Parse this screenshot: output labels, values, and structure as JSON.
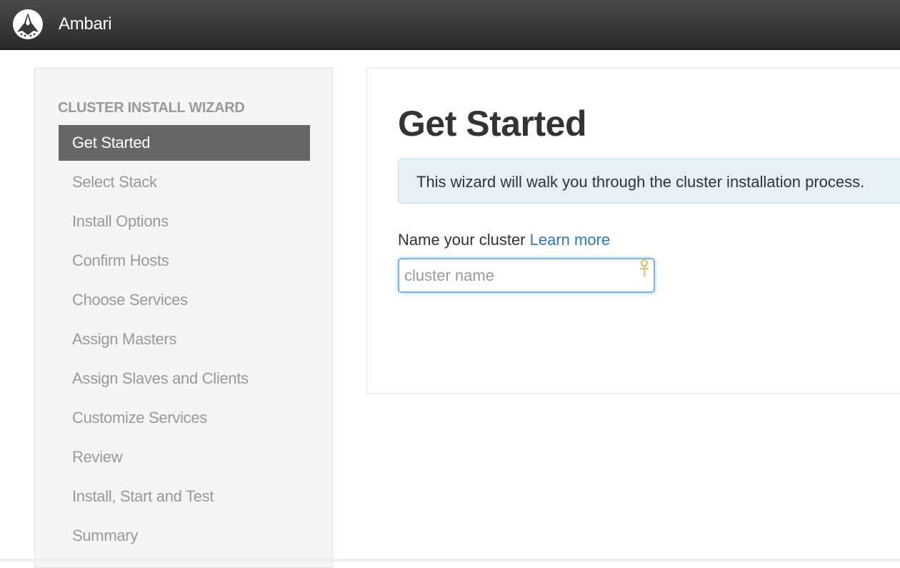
{
  "app": {
    "brand": "Ambari"
  },
  "sidebar": {
    "header": "CLUSTER INSTALL WIZARD",
    "items": [
      {
        "label": "Get Started",
        "active": true
      },
      {
        "label": "Select Stack",
        "active": false
      },
      {
        "label": "Install Options",
        "active": false
      },
      {
        "label": "Confirm Hosts",
        "active": false
      },
      {
        "label": "Choose Services",
        "active": false
      },
      {
        "label": "Assign Masters",
        "active": false
      },
      {
        "label": "Assign Slaves and Clients",
        "active": false
      },
      {
        "label": "Customize Services",
        "active": false
      },
      {
        "label": "Review",
        "active": false
      },
      {
        "label": "Install, Start and Test",
        "active": false
      },
      {
        "label": "Summary",
        "active": false
      }
    ]
  },
  "main": {
    "title": "Get Started",
    "alert": "This wizard will walk you through the cluster installation process.",
    "name_label": "Name your cluster",
    "learn_more": "Learn more",
    "cluster_name": {
      "value": "",
      "placeholder": "cluster name"
    }
  },
  "icons": {
    "logo": "ambari-logo-icon",
    "password_manager": "key-icon"
  },
  "colors": {
    "topbar": "#333333",
    "active_nav": "#666666",
    "link": "#2c7ab8",
    "alert_bg": "#e6f0f5"
  }
}
